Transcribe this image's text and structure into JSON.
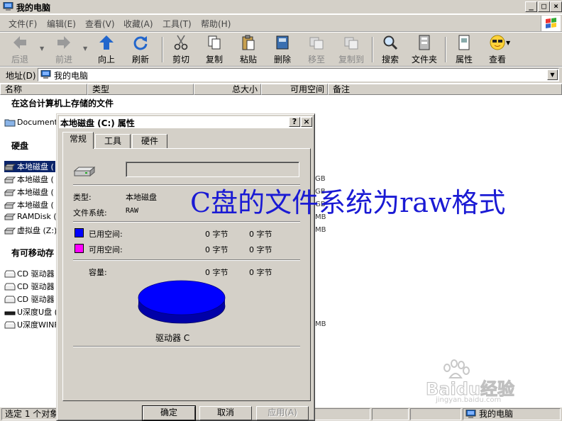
{
  "window": {
    "title": "我的电脑",
    "min_glyph": "_",
    "max_glyph": "□",
    "close_glyph": "×"
  },
  "menu": [
    {
      "label": "文件(F)"
    },
    {
      "label": "编辑(E)"
    },
    {
      "label": "查看(V)"
    },
    {
      "label": "收藏(A)"
    },
    {
      "label": "工具(T)"
    },
    {
      "label": "帮助(H)"
    }
  ],
  "toolbar": {
    "back": "后退",
    "forward": "前进",
    "up": "向上",
    "refresh": "刷新",
    "cut": "剪切",
    "copy": "复制",
    "paste": "粘贴",
    "delete": "删除",
    "move": "移至",
    "copyto": "复制到",
    "search": "搜索",
    "folders": "文件夹",
    "properties": "属性",
    "view": "查看"
  },
  "address": {
    "label": "地址(D)",
    "value": "我的电脑"
  },
  "columns": [
    "名称",
    "类型",
    "总大小",
    "可用空间",
    "备注"
  ],
  "groups": {
    "stored": "在这台计算机上存储的文件",
    "harddisks": "硬盘",
    "removable": "有可移动存"
  },
  "items": {
    "documents": "Documents",
    "disks": [
      {
        "label": "本地磁盘 (",
        "unit": ""
      },
      {
        "label": "本地磁盘 (",
        "unit": "GB"
      },
      {
        "label": "本地磁盘 (",
        "unit": "GB"
      },
      {
        "label": "本地磁盘 (",
        "unit": "GB"
      },
      {
        "label": "RAMDisk (Y",
        "unit": "MB"
      },
      {
        "label": "虚拟盘 (Z:)",
        "unit": "MB"
      }
    ],
    "removable": [
      {
        "label": "CD 驱动器",
        "unit": ""
      },
      {
        "label": "CD 驱动器",
        "unit": ""
      },
      {
        "label": "CD 驱动器",
        "unit": ""
      },
      {
        "label": "U深度U盘 (",
        "unit": ""
      },
      {
        "label": "U深度WINF",
        "unit": "MB"
      }
    ]
  },
  "status": {
    "selected": "选定 1 个对象",
    "location": "我的电脑"
  },
  "dialog": {
    "title": "本地磁盘 (C:) 属性",
    "help_glyph": "?",
    "close_glyph": "×",
    "tabs": [
      "常规",
      "工具",
      "硬件"
    ],
    "name_value": "",
    "type_label": "类型:",
    "type_value": "本地磁盘",
    "fs_label": "文件系统:",
    "fs_value": "RAW",
    "used_label": "已用空间:",
    "used_bytes": "0 字节",
    "used_human": "0 字节",
    "free_label": "可用空间:",
    "free_bytes": "0 字节",
    "free_human": "0 字节",
    "capacity_label": "容量:",
    "capacity_bytes": "0 字节",
    "capacity_human": "0 字节",
    "drive_label": "驱动器 C",
    "ok": "确定",
    "cancel": "取消",
    "apply": "应用(A)",
    "colors": {
      "used": "#0000ff",
      "free": "#ff00ff"
    }
  },
  "overlay": {
    "text": "C盘的文件系统为raw格式",
    "color": "#1a1ad4"
  },
  "watermark": {
    "logo": "Baidu经验",
    "url": "jingyan.baidu.com"
  }
}
